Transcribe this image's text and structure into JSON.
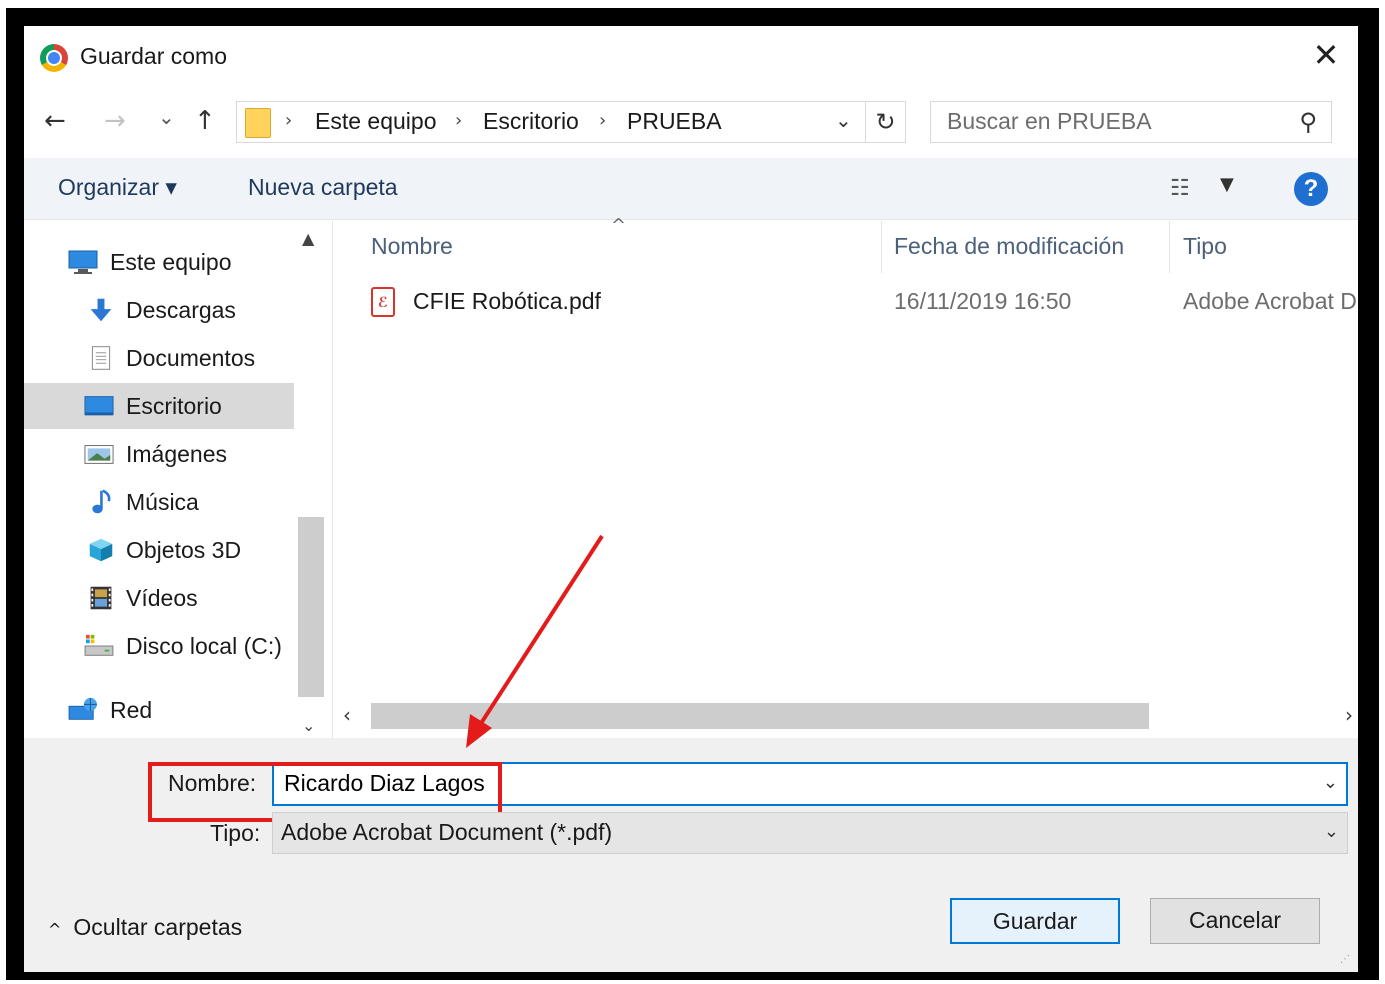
{
  "window": {
    "title": "Guardar como",
    "close": "✕"
  },
  "nav": {
    "back": "←",
    "forward": "→",
    "recent": "⌄",
    "up": "↑",
    "breadcrumb": [
      "Este equipo",
      "Escritorio",
      "PRUEBA"
    ],
    "refresh": "↻",
    "search_placeholder": "Buscar en PRUEBA"
  },
  "toolbar": {
    "organize": "Organizar ▾",
    "new_folder": "Nueva carpeta",
    "help": "?"
  },
  "sidebar": {
    "items": [
      {
        "label": "Este equipo",
        "icon": "computer-icon"
      },
      {
        "label": "Descargas",
        "icon": "download-icon"
      },
      {
        "label": "Documentos",
        "icon": "documents-icon"
      },
      {
        "label": "Escritorio",
        "icon": "desktop-icon",
        "selected": true
      },
      {
        "label": "Imágenes",
        "icon": "pictures-icon"
      },
      {
        "label": "Música",
        "icon": "music-icon"
      },
      {
        "label": "Objetos 3D",
        "icon": "objects-3d-icon"
      },
      {
        "label": "Vídeos",
        "icon": "videos-icon"
      },
      {
        "label": "Disco local (C:)",
        "icon": "drive-icon"
      },
      {
        "label": "Red",
        "icon": "network-icon"
      }
    ]
  },
  "files": {
    "columns": [
      "Nombre",
      "Fecha de modificación",
      "Tipo"
    ],
    "rows": [
      {
        "name": "CFIE Robótica.pdf",
        "date": "16/11/2019 16:50",
        "type": "Adobe Acrobat D"
      }
    ]
  },
  "form": {
    "name_label": "Nombre:",
    "name_value": "Ricardo Diaz Lagos",
    "type_label": "Tipo:",
    "type_value": "Adobe Acrobat Document (*.pdf)"
  },
  "footer": {
    "hide_folders": "Ocultar carpetas",
    "save": "Guardar",
    "cancel": "Cancelar"
  },
  "colors": {
    "accent": "#0078d7",
    "annotation": "#e31b1b",
    "selection": "#d9d9d9"
  }
}
